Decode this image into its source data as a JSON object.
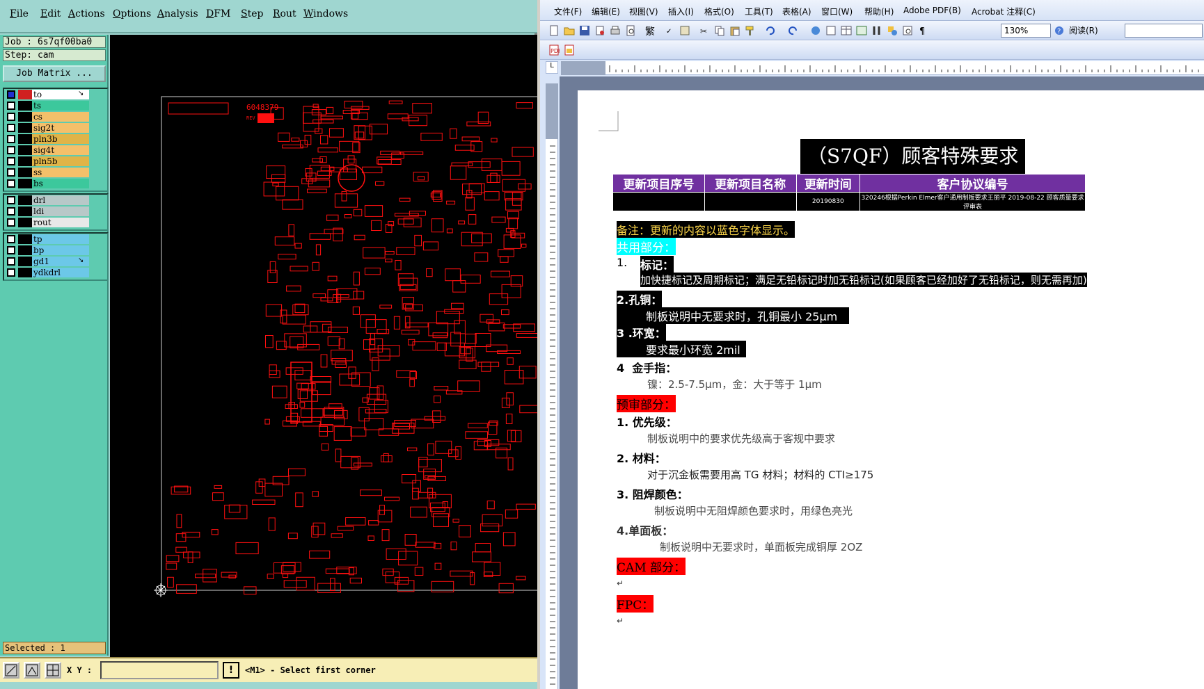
{
  "cam": {
    "menu": [
      "File",
      "Edit",
      "Actions",
      "Options",
      "Analysis",
      "DFM",
      "Step",
      "Rout",
      "Windows"
    ],
    "job_label": "Job : 6s7qf00ba0",
    "step_label": "Step: cam",
    "job_matrix_button": "Job Matrix ...",
    "layer_groups": [
      [
        {
          "name": "to",
          "color": "#ffffff",
          "checked": true,
          "ext": "↘"
        },
        {
          "name": "ts",
          "color": "#3cc89c",
          "checked": false
        },
        {
          "name": "cs",
          "color": "#f4c06a",
          "checked": false
        },
        {
          "name": "sig2t",
          "color": "#f4c06a",
          "checked": false
        },
        {
          "name": "pln3b",
          "color": "#e0b448",
          "checked": false
        },
        {
          "name": "sig4t",
          "color": "#f4c06a",
          "checked": false
        },
        {
          "name": "pln5b",
          "color": "#e0b448",
          "checked": false
        },
        {
          "name": "ss",
          "color": "#f4c06a",
          "checked": false
        },
        {
          "name": "bs",
          "color": "#3cc89c",
          "checked": false
        }
      ],
      [
        {
          "name": "drl",
          "color": "#b8c8c8",
          "checked": false
        },
        {
          "name": "ldi",
          "color": "#b8c8c8",
          "checked": false
        },
        {
          "name": "rout",
          "color": "#e8e8e8",
          "checked": false
        }
      ],
      [
        {
          "name": "tp",
          "color": "#6cc8e8",
          "checked": false
        },
        {
          "name": "bp",
          "color": "#6cc8e8",
          "checked": false
        },
        {
          "name": "gd1",
          "color": "#6cc8e8",
          "checked": false,
          "ext": "↘"
        },
        {
          "name": "ydkdrl",
          "color": "#6cc8e8",
          "checked": false
        }
      ]
    ],
    "selected_label": "Selected : 1",
    "xy_label": "X Y :",
    "xy_value": "",
    "warn_label": "!",
    "status_message": "<M1> - Select first corner",
    "board_part_number": "6048379",
    "board_rev_label": "REV"
  },
  "word": {
    "menu": [
      "文件(F)",
      "编辑(E)",
      "视图(V)",
      "插入(I)",
      "格式(O)",
      "工具(T)",
      "表格(A)",
      "窗口(W)",
      "帮助(H)",
      "Adobe PDF(B)",
      "Acrobat 注释(C)"
    ],
    "zoom": "130%",
    "read_button": "阅读(R)",
    "doc": {
      "title": "（S7QF）顾客特殊要求",
      "table_headers": [
        "更新项目序号",
        "更新项目名称",
        "更新时间",
        "客户协议编号"
      ],
      "table_row": [
        "",
        "",
        "20190830",
        "320246根据Perkin Elmer客户通用制板要求王丽平 2019-08-22 顾客质量要求评审表"
      ],
      "note": "备注：更新的内容以蓝色字体显示。",
      "common_header": "共用部分：",
      "items": [
        {
          "num": "1.",
          "title": "标记：",
          "body": "加快捷标记及周期标记；满足无铅标记时加无铅标记(如果顾客已经加好了无铅标记，则无需再加)"
        },
        {
          "num": "2.",
          "title": "孔铜：",
          "body": "制板说明中无要求时，孔铜最小 25μm"
        },
        {
          "num": "3 .",
          "title": "环宽：",
          "body": "要求最小环宽 2mil"
        },
        {
          "num": "4",
          "title": "金手指：",
          "body": "镍：2.5-7.5μm，金：大于等于 1μm"
        }
      ],
      "pre_header": "预审部分：",
      "pre_items": [
        {
          "num": "1.",
          "title": "优先级：",
          "body": "制板说明中的要求优先级高于客规中要求"
        },
        {
          "num": "2.",
          "title": "材料：",
          "body": "对于沉金板需要用高 TG 材料；材料的 CTI≥175"
        },
        {
          "num": "3.",
          "title": "阻焊颜色：",
          "body": "制板说明中无阻焊颜色要求时，用绿色亮光"
        },
        {
          "num": "4.",
          "title": "单面板：",
          "body": "制板说明中无要求时，单面板完成铜厚 2OZ"
        }
      ],
      "cam_header": "CAM 部分：",
      "fpc_header": "FPC："
    }
  }
}
